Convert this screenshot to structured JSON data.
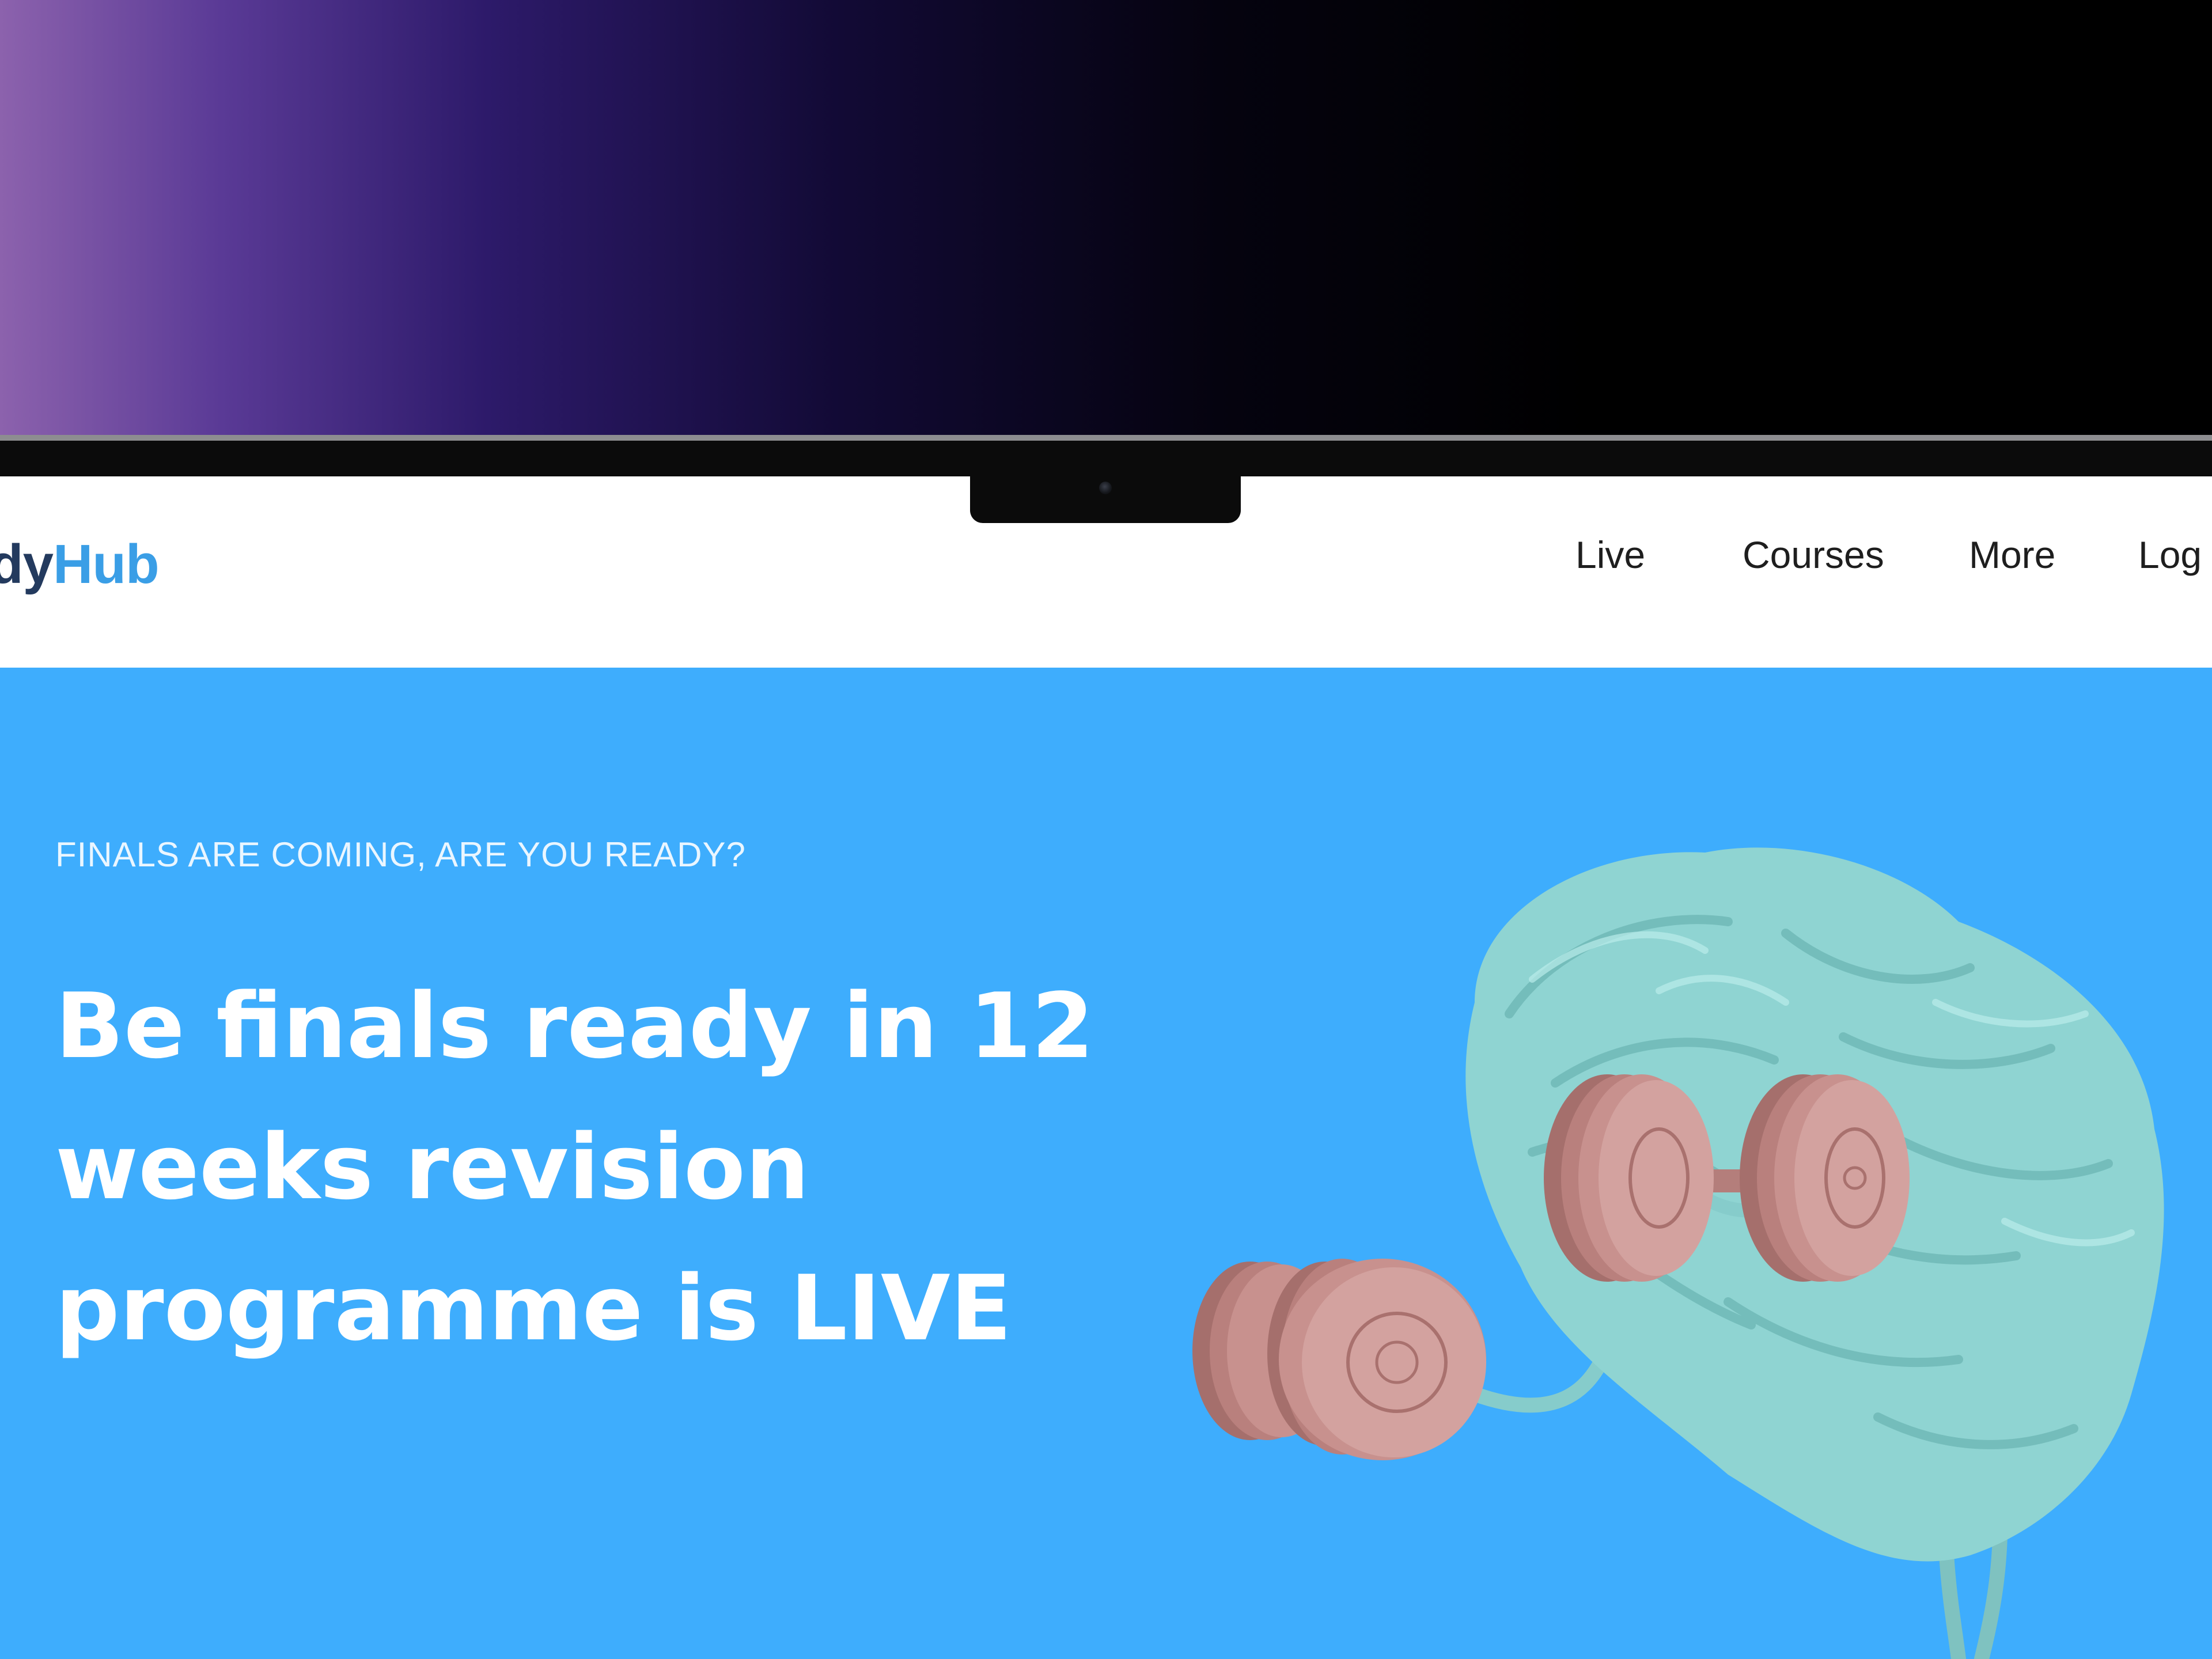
{
  "navbar": {
    "logo_part1": "dy",
    "logo_part2": "Hub",
    "items": [
      {
        "label": "Live"
      },
      {
        "label": "Courses"
      },
      {
        "label": "More"
      },
      {
        "label": "Log"
      }
    ]
  },
  "hero": {
    "eyebrow": "FINALS ARE COMING, ARE YOU READY?",
    "headline": "Be finals ready in 12 weeks revision programme is LIVE",
    "image_icon": "brain-lifting-dumbbells-illustration"
  },
  "colors": {
    "hero_bg": "#3eadfd",
    "logo_dark": "#233a5e",
    "logo_accent": "#3a9ee6",
    "brain": "#8fd3d3",
    "dumbbell": "#c98f8c"
  }
}
